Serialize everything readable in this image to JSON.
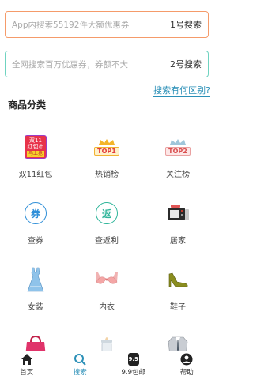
{
  "search": {
    "in_app_placeholder": "App内搜索55192件大额优惠券",
    "in_app_tag": "1号搜索",
    "network_placeholder": "全网搜索百万优惠券，券额不大",
    "network_tag": "2号搜索",
    "diff_link": "搜索有何区别?"
  },
  "categories_title": "商品分类",
  "categories": [
    {
      "label": "双11红包",
      "icon": "double11-badge-icon",
      "badge_lines": [
        "双11",
        "红包币",
        "马上抢"
      ]
    },
    {
      "label": "热销榜",
      "icon": "top1-crown-icon",
      "badge": "TOP1"
    },
    {
      "label": "关注榜",
      "icon": "top2-crown-icon",
      "badge": "TOP2"
    },
    {
      "label": "查券",
      "icon": "coupon-circle-icon",
      "glyph": "券"
    },
    {
      "label": "查返利",
      "icon": "rebate-circle-icon",
      "glyph": "返"
    },
    {
      "label": "居家",
      "icon": "home-appliance-icon"
    },
    {
      "label": "女装",
      "icon": "dress-icon"
    },
    {
      "label": "内衣",
      "icon": "bra-icon"
    },
    {
      "label": "鞋子",
      "icon": "high-heel-icon"
    },
    {
      "label": "",
      "icon": "handbag-icon"
    },
    {
      "label": "",
      "icon": "baby-bottle-icon"
    },
    {
      "label": "",
      "icon": "suit-icon"
    }
  ],
  "tabbar": [
    {
      "label": "首页",
      "icon": "home-icon"
    },
    {
      "label": "搜索",
      "icon": "search-icon",
      "active": true
    },
    {
      "label": "9.9包邮",
      "icon": "nine-nine-icon",
      "glyph": "9.9"
    },
    {
      "label": "帮助",
      "icon": "user-help-icon"
    }
  ],
  "colors": {
    "search1_border": "#f59b6a",
    "search2_border": "#6fd3c0",
    "link": "#2a8fb7"
  }
}
